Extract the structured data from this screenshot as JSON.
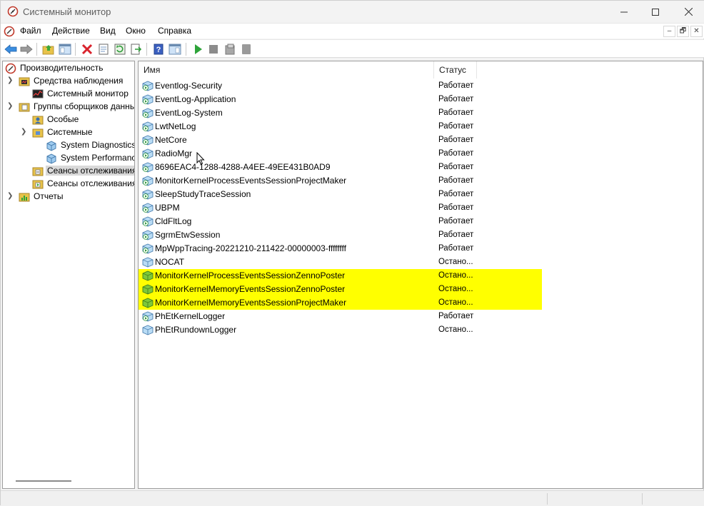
{
  "window": {
    "title": "Системный монитор",
    "icon": "performance-monitor-icon"
  },
  "menu": {
    "items": [
      "Файл",
      "Действие",
      "Вид",
      "Окно",
      "Справка"
    ],
    "mdi_minimize": "–",
    "mdi_restore": "🗗",
    "mdi_close": "✕"
  },
  "toolbar": {
    "buttons": [
      "back-icon",
      "forward-icon",
      "up-folder-icon",
      "show-hide-tree-icon",
      "delete-icon",
      "properties-icon",
      "refresh-icon",
      "export-icon",
      "help-icon",
      "show-hide-action-pane-icon",
      "start-icon",
      "stop-icon",
      "save-template-icon",
      "disabled-icon"
    ]
  },
  "tree": {
    "items": [
      {
        "label": "Производительность",
        "icon": "performance-icon"
      },
      {
        "label": "Средства наблюдения",
        "icon": "monitoring-tools-icon"
      },
      {
        "label": "Системный монитор",
        "icon": "performance-monitor-icon"
      },
      {
        "label": "Группы сборщиков данных",
        "icon": "data-collector-sets-icon"
      },
      {
        "label": "Особые",
        "icon": "user-defined-icon"
      },
      {
        "label": "Системные",
        "icon": "system-sets-icon"
      },
      {
        "label": "System Diagnostics",
        "icon": "collector-set-icon"
      },
      {
        "label": "System Performance",
        "icon": "collector-set-icon"
      },
      {
        "label": "Сеансы отслеживания событий",
        "icon": "event-trace-sessions-icon"
      },
      {
        "label": "Сеансы отслеживания событий запуска",
        "icon": "startup-event-trace-icon"
      },
      {
        "label": "Отчеты",
        "icon": "reports-icon"
      }
    ]
  },
  "list": {
    "columns": {
      "name": "Имя",
      "status": "Статус"
    },
    "rows": [
      {
        "name": "Eventlog-Security",
        "status": "Работает"
      },
      {
        "name": "EventLog-Application",
        "status": "Работает"
      },
      {
        "name": "EventLog-System",
        "status": "Работает"
      },
      {
        "name": "LwtNetLog",
        "status": "Работает"
      },
      {
        "name": "NetCore",
        "status": "Работает"
      },
      {
        "name": "RadioMgr",
        "status": "Работает"
      },
      {
        "name": "8696EAC4-1288-4288-A4EE-49EE431B0AD9",
        "status": "Работает"
      },
      {
        "name": "MonitorKernelProcessEventsSessionProjectMaker",
        "status": "Работает"
      },
      {
        "name": "SleepStudyTraceSession",
        "status": "Работает"
      },
      {
        "name": "UBPM",
        "status": "Работает"
      },
      {
        "name": "CldFltLog",
        "status": "Работает"
      },
      {
        "name": "SgrmEtwSession",
        "status": "Работает"
      },
      {
        "name": "MpWppTracing-20221210-211422-00000003-ffffffff",
        "status": "Работает"
      },
      {
        "name": "NOCAT",
        "status": "Остано..."
      },
      {
        "name": "MonitorKernelProcessEventsSessionZennoPoster",
        "status": "Остано..."
      },
      {
        "name": "MonitorKernelMemoryEventsSessionZennoPoster",
        "status": "Остано..."
      },
      {
        "name": "MonitorKernelMemoryEventsSessionProjectMaker",
        "status": "Остано..."
      },
      {
        "name": "PhEtKernelLogger",
        "status": "Работает"
      },
      {
        "name": "PhEtRundownLogger",
        "status": "Остано..."
      }
    ],
    "highlight_color": "#ffff00"
  }
}
